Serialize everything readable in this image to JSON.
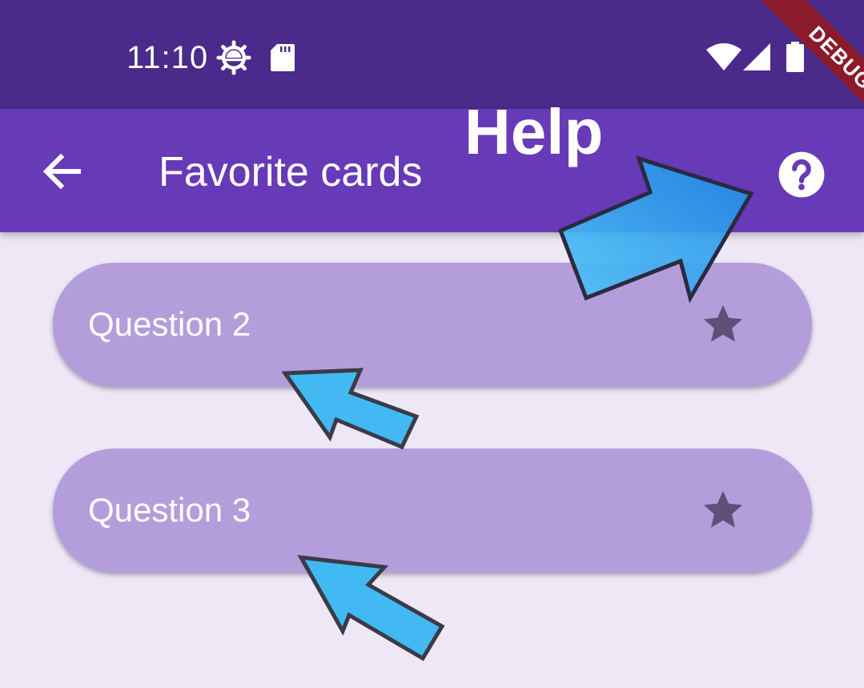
{
  "status_bar": {
    "time": "11:10",
    "icons": [
      "settings-gear-icon",
      "sd-card-icon",
      "wifi-icon",
      "cell-signal-icon",
      "battery-icon"
    ]
  },
  "app_bar": {
    "back_icon": "arrow-back-icon",
    "title": "Favorite cards",
    "help_icon": "help-circle-icon"
  },
  "cards": [
    {
      "label": "Question 2",
      "icon": "star-icon"
    },
    {
      "label": "Question 3",
      "icon": "star-icon"
    }
  ],
  "debug_banner": "DEBUG",
  "annotation": {
    "label": "Help",
    "arrow_color": "#2196f3"
  },
  "colors": {
    "status_bar": "#4a2a8a",
    "app_bar": "#673ab7",
    "background": "#ede7f6",
    "card": "#b39ddb",
    "star": "#5e5078",
    "debug": "#8b1a2b"
  }
}
